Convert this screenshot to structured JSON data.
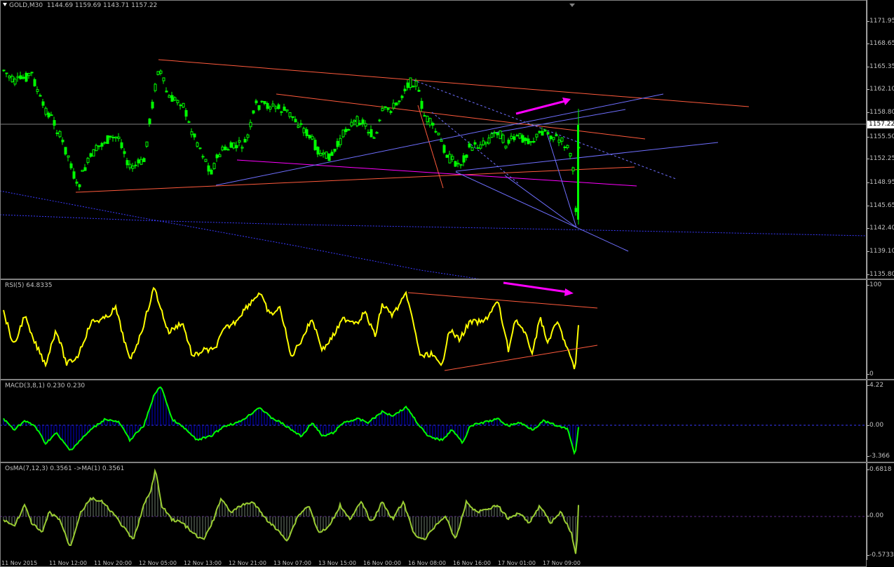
{
  "main": {
    "symbol": "GOLD,M30",
    "ohlc": "1144.69 1159.69 1143.71 1157.22",
    "price_ticks": [
      "1171.95",
      "1168.65",
      "1165.35",
      "1162.10",
      "1158.80",
      "1155.50",
      "1152.25",
      "1148.95",
      "1145.65",
      "1142.40",
      "1139.10",
      "1135.80"
    ],
    "current_price": "1157.22",
    "colors": {
      "bull": "#00ff00",
      "bear": "#00ff00",
      "bid_line": "#808080"
    }
  },
  "rsi": {
    "label": "RSI(5) 64.8335",
    "ticks": [
      "100",
      "0"
    ],
    "color": "#ffff00"
  },
  "macd": {
    "label": "MACD(3,8,1) 0.230 0.230",
    "ticks": [
      "4.22",
      "0.00",
      "-3.366"
    ],
    "colors": {
      "hist": "#0000cc",
      "signal": "#00ff00"
    }
  },
  "osma": {
    "label": "OsMA(7,12,3) 0.3561  ->MA(1) 0.3561",
    "ticks": [
      "0.6818",
      "0.00",
      "-0.5733"
    ],
    "colors": {
      "hist": "#607060",
      "line": "#9acd32"
    }
  },
  "time_axis": [
    "11 Nov 2015",
    "11 Nov 12:00",
    "11 Nov 20:00",
    "12 Nov 05:00",
    "12 Nov 13:00",
    "12 Nov 21:00",
    "13 Nov 07:00",
    "13 Nov 15:00",
    "16 Nov 00:00",
    "16 Nov 08:00",
    "16 Nov 16:00",
    "17 Nov 01:00",
    "17 Nov 09:00"
  ]
}
